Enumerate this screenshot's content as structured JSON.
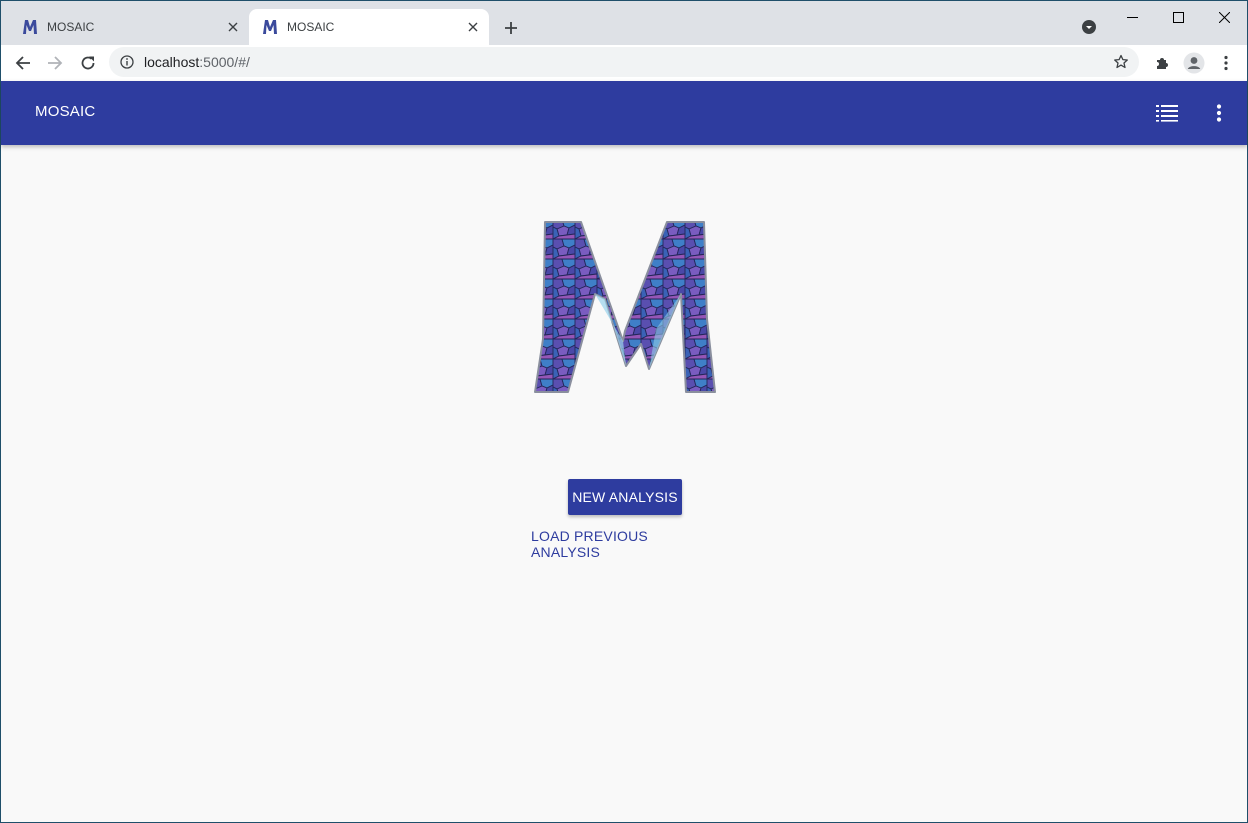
{
  "browser": {
    "tabs": [
      {
        "title": "MOSAIC",
        "active": false
      },
      {
        "title": "MOSAIC",
        "active": true
      }
    ],
    "url_host": "localhost",
    "url_rest": ":5000/#/"
  },
  "app": {
    "title": "MOSAIC",
    "brand_color": "#2e3c9f",
    "icons": {
      "list": "format-list-icon",
      "more": "more-vert-icon"
    }
  },
  "main": {
    "new_analysis_label": "NEW ANALYSIS",
    "load_previous_label": "LOAD PREVIOUS ANALYSIS"
  }
}
